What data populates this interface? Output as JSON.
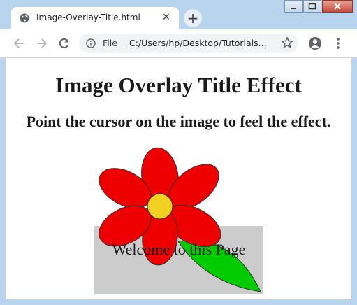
{
  "browser": {
    "tab_title": "Image-Overlay-Title.html",
    "new_tab_symbol": "+",
    "close_tab_symbol": "✕",
    "omnibox": {
      "scheme_label": "File",
      "url": "C:/Users/hp/Desktop/Tutorials..."
    }
  },
  "page": {
    "title": "Image Overlay Title Effect",
    "subtitle": "Point the cursor on the image to feel the effect.",
    "overlay_text": "Welcome to this Page"
  },
  "image": {
    "alt": "flower",
    "petal_color": "#ee0000",
    "center_color": "#f0d020",
    "leaf_color": "#00cc00"
  },
  "colors": {
    "window_frame": "#b9d4ee",
    "overlay": "#c8c8c8"
  }
}
